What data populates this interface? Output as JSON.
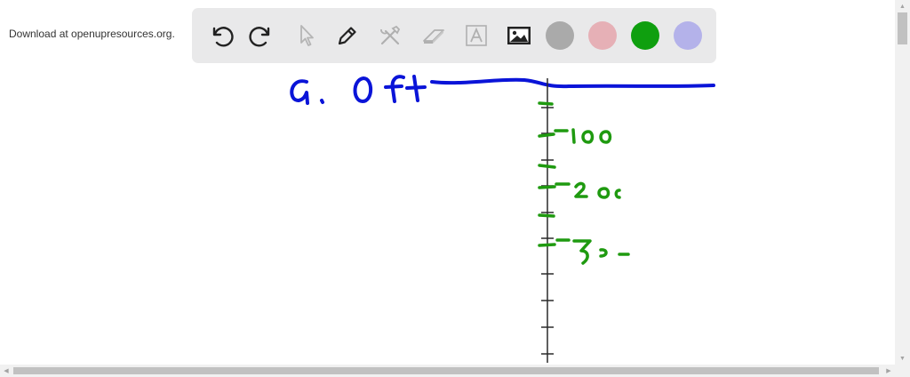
{
  "header": {
    "download_text": "Download at openupresources.org."
  },
  "toolbar": {
    "tools": [
      {
        "name": "undo-icon",
        "enabled": true
      },
      {
        "name": "redo-icon",
        "enabled": true
      },
      {
        "name": "pointer-icon",
        "enabled": false
      },
      {
        "name": "pen-icon",
        "enabled": true
      },
      {
        "name": "tools-icon",
        "enabled": false
      },
      {
        "name": "eraser-icon",
        "enabled": false
      },
      {
        "name": "text-icon",
        "enabled": false
      },
      {
        "name": "image-icon",
        "enabled": true
      }
    ],
    "colors": [
      "#aaaaaa",
      "#e6b0b6",
      "#0f9f0f",
      "#b4b2ea"
    ],
    "selected_color": "#0f9f0f"
  },
  "canvas": {
    "ink_blue": "#0a14d8",
    "ink_green": "#1f9a10",
    "axis_color": "#2a2a2a"
  }
}
